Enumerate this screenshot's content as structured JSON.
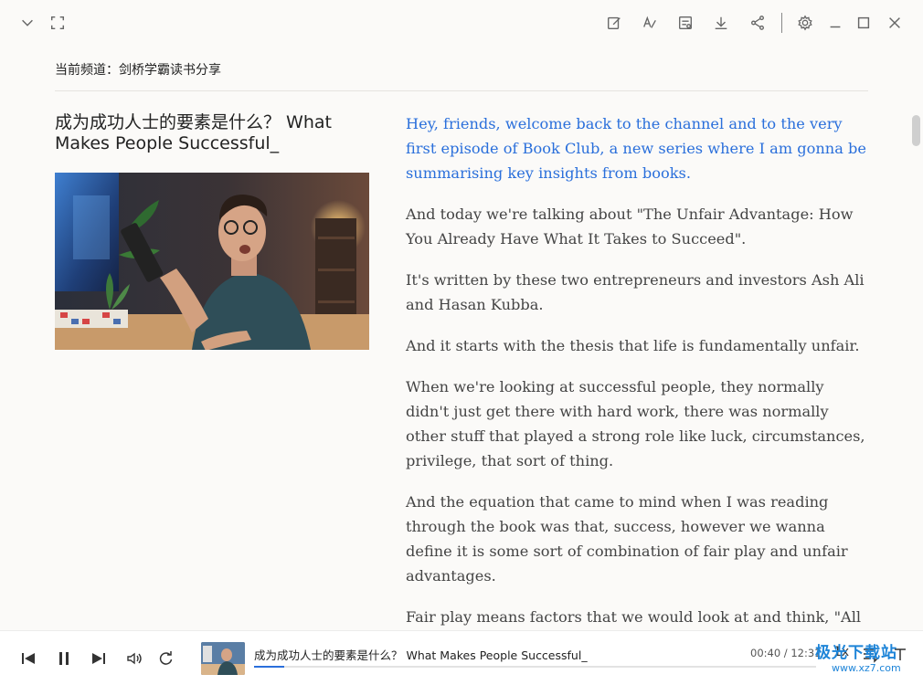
{
  "channel": {
    "label": "当前频道：剑桥学霸读书分享"
  },
  "video": {
    "title": "成为成功人士的要素是什么？ What Makes People Successful_"
  },
  "transcript": [
    {
      "text": "Hey, friends, welcome back to the channel and to the very first episode of Book Club, a new series where I am gonna be summarising key insights from books.",
      "active": true
    },
    {
      "text": "And today we're talking about \"The Unfair Advantage: How You Already Have What It Takes to Succeed\".",
      "active": false
    },
    {
      "text": "It's written by these two entrepreneurs and investors Ash Ali and Hasan Kubba.",
      "active": false
    },
    {
      "text": "And it starts with the thesis that life is fundamentally unfair.",
      "active": false
    },
    {
      "text": "When we're looking at successful people, they normally didn't just get there with hard work, there was normally other stuff that played a strong role like luck, circumstances, privilege, that sort of thing.",
      "active": false
    },
    {
      "text": "And the equation that came to mind when I was reading through the book was that, success, however we wanna define it is some sort of combination of fair play and unfair advantages.",
      "active": false
    },
    {
      "text": "Fair play means factors that we would look at and think, \"All",
      "active": false
    }
  ],
  "player": {
    "now_title": "成为成功人士的要素是什么？ What Makes People Successful_",
    "time": "00:40 / 12:31",
    "speed": "1x",
    "progress": 0.053
  },
  "watermark": {
    "main": "极光下载站",
    "sub": "www.xz7.com"
  },
  "colors": {
    "accent": "#2a6fdb",
    "background": "#fbfaf8"
  }
}
